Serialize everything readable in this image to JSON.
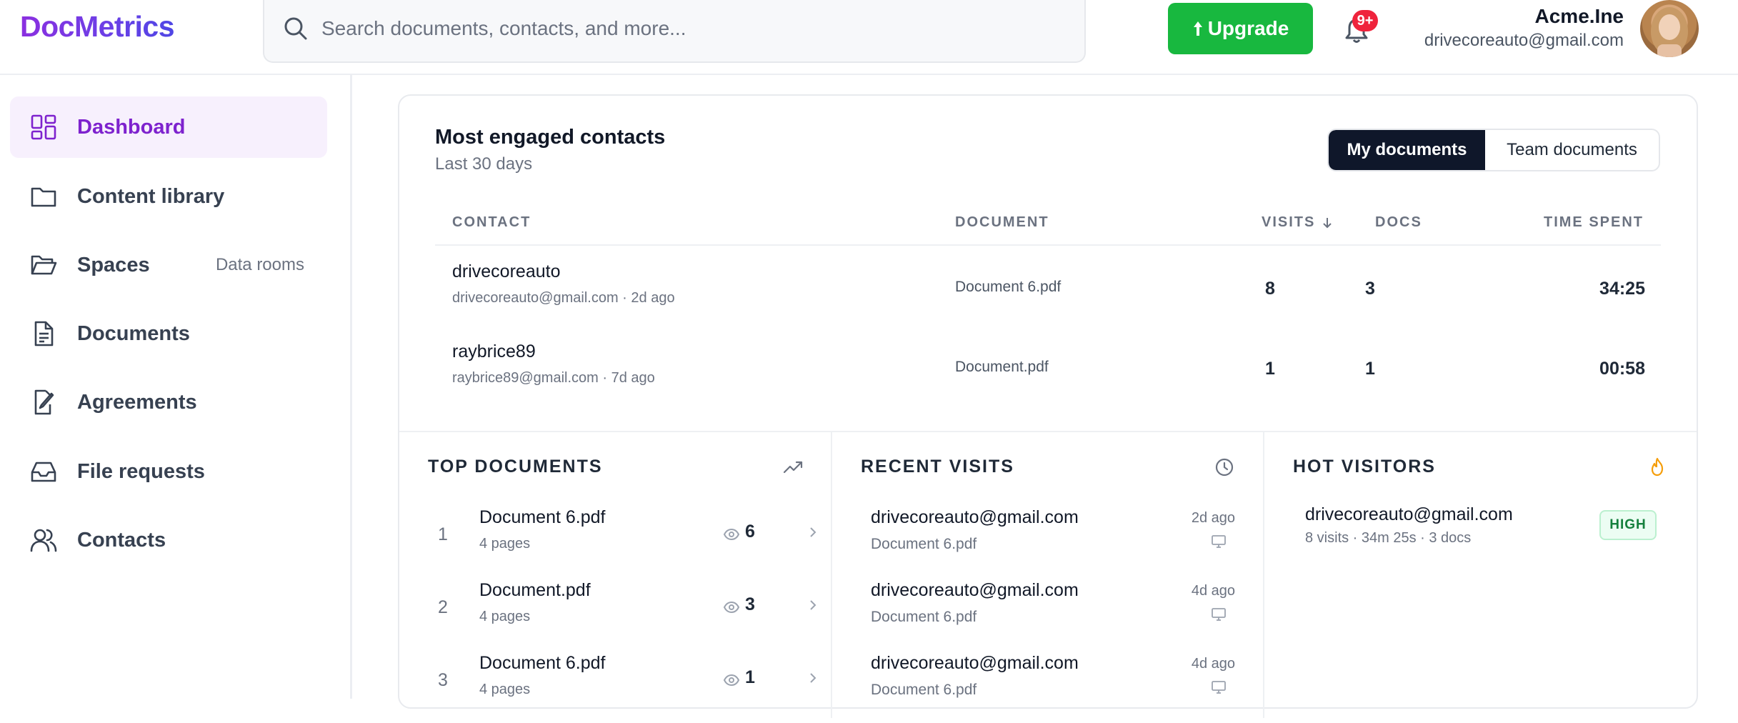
{
  "header": {
    "logo": "DocMetrics",
    "search_placeholder": "Search documents, contacts, and more...",
    "upgrade_label": "Upgrade",
    "notification_badge": "9+",
    "account_name": "Acme.Ine",
    "account_email": "drivecoreauto@gmail.com"
  },
  "sidebar": {
    "items": [
      {
        "label": "Dashboard",
        "icon": "dashboard-icon",
        "active": true
      },
      {
        "label": "Content library",
        "icon": "folder-icon"
      },
      {
        "label": "Spaces",
        "icon": "folder-open-icon",
        "sub": "Data rooms"
      },
      {
        "label": "Documents",
        "icon": "document-icon"
      },
      {
        "label": "Agreements",
        "icon": "signature-icon"
      },
      {
        "label": "File requests",
        "icon": "inbox-icon"
      },
      {
        "label": "Contacts",
        "icon": "users-icon"
      }
    ]
  },
  "engaged": {
    "title": "Most engaged contacts",
    "subtitle": "Last 30 days",
    "toggle": {
      "my": "My documents",
      "team": "Team documents",
      "selected": "My documents"
    },
    "columns": {
      "contact": "CONTACT",
      "document": "DOCUMENT",
      "visits": "VISITS",
      "docs": "DOCS",
      "time": "TIME SPENT"
    },
    "rows": [
      {
        "name": "drivecoreauto",
        "meta": "drivecoreauto@gmail.com · 2d ago",
        "document": "Document 6.pdf",
        "visits": "8",
        "docs": "3",
        "time": "34:25"
      },
      {
        "name": "raybrice89",
        "meta": "raybrice89@gmail.com · 7d ago",
        "document": "Document.pdf",
        "visits": "1",
        "docs": "1",
        "time": "00:58"
      }
    ]
  },
  "top_documents": {
    "title": "TOP DOCUMENTS",
    "items": [
      {
        "rank": "1",
        "name": "Document 6.pdf",
        "pages": "4 pages",
        "views": "6"
      },
      {
        "rank": "2",
        "name": "Document.pdf",
        "pages": "4 pages",
        "views": "3"
      },
      {
        "rank": "3",
        "name": "Document 6.pdf",
        "pages": "4 pages",
        "views": "1"
      }
    ]
  },
  "recent_visits": {
    "title": "RECENT VISITS",
    "items": [
      {
        "email": "drivecoreauto@gmail.com",
        "document": "Document 6.pdf",
        "when": "2d ago"
      },
      {
        "email": "drivecoreauto@gmail.com",
        "document": "Document 6.pdf",
        "when": "4d ago"
      },
      {
        "email": "drivecoreauto@gmail.com",
        "document": "Document 6.pdf",
        "when": "4d ago"
      }
    ]
  },
  "hot_visitors": {
    "title": "HOT VISITORS",
    "items": [
      {
        "email": "drivecoreauto@gmail.com",
        "meta": "8 visits · 34m 25s · 3 docs",
        "level": "HIGH"
      }
    ]
  },
  "colors": {
    "accent": "#7e22ce",
    "upgrade": "#18b83f",
    "badge": "#ef233c",
    "toggle_active": "#0f172a",
    "high": "#15803d",
    "flame": "#f59e0b"
  }
}
